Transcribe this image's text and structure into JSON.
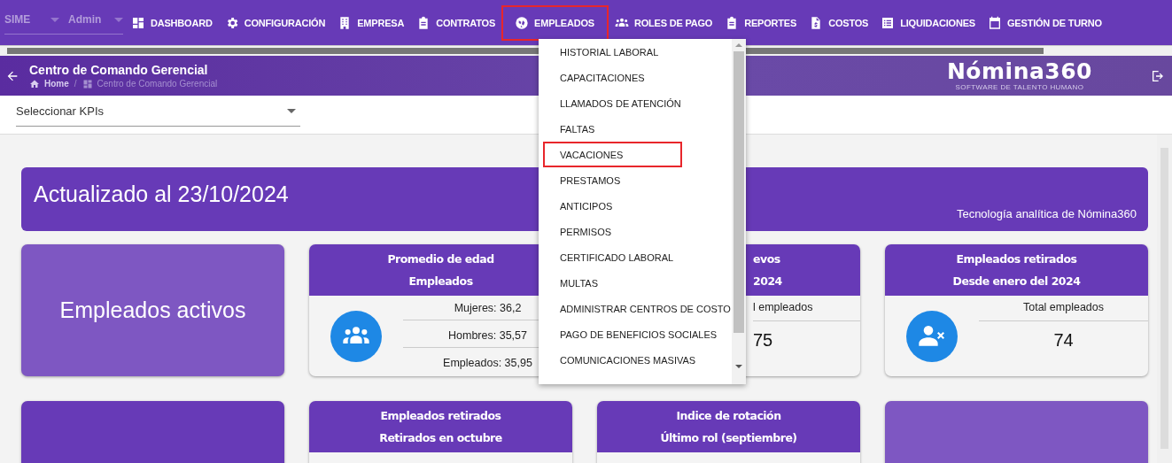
{
  "nav": {
    "selects": [
      {
        "value": "SIME"
      },
      {
        "value": "Admin"
      }
    ],
    "items": [
      {
        "label": "DASHBOARD",
        "outlined": false
      },
      {
        "label": "CONFIGURACIÓN",
        "outlined": false
      },
      {
        "label": "EMPRESA",
        "outlined": false
      },
      {
        "label": "CONTRATOS",
        "outlined": false
      },
      {
        "label": "EMPLEADOS",
        "outlined": true
      },
      {
        "label": "ROLES DE PAGO",
        "outlined": false
      },
      {
        "label": "REPORTES",
        "outlined": false
      },
      {
        "label": "COSTOS",
        "outlined": false
      },
      {
        "label": "LIQUIDACIONES",
        "outlined": false
      },
      {
        "label": "GESTIÓN DE TURNO",
        "outlined": false
      }
    ]
  },
  "header": {
    "title": "Centro de Comando Gerencial",
    "breadcrumb": [
      {
        "label": "Home"
      },
      {
        "label": "Centro de Comando Gerencial"
      }
    ],
    "breadcrumb_separator": "/",
    "logo": {
      "name": "Nómina360",
      "tagline": "SOFTWARE DE TALENTO HUMANO"
    }
  },
  "kpi_select": {
    "placeholder": "Seleccionar KPIs"
  },
  "banner": {
    "title": "Actualizado al 23/10/2024",
    "caption": "Tecnología analítica de Nómina360"
  },
  "cards": [
    {
      "kind": "title",
      "text": "Empleados activos"
    },
    {
      "kind": "stats",
      "header": [
        "Promedio de edad",
        "Empleados"
      ],
      "rows": [
        "Mujeres: 36,2",
        "Hombres: 35,57",
        "Empleados: 35,95"
      ]
    },
    {
      "kind": "total",
      "covered": true,
      "header": [
        "evos",
        "2024"
      ],
      "label": "l empleados",
      "value": "75"
    },
    {
      "kind": "total",
      "covered": false,
      "header": [
        "Empleados retirados",
        "Desde enero del 2024"
      ],
      "label": "Total empleados",
      "value": "74"
    }
  ],
  "cards_row2": [
    {
      "kind": "filled-dark"
    },
    {
      "kind": "header",
      "header": [
        "Empleados retirados",
        "Retirados en octubre"
      ]
    },
    {
      "kind": "header",
      "header": [
        "Indice de rotación",
        "Último rol (septiembre)"
      ]
    },
    {
      "kind": "filled-light"
    }
  ],
  "dropdown": {
    "items": [
      {
        "label": "HISTORIAL LABORAL",
        "outlined": false
      },
      {
        "label": "CAPACITACIONES",
        "outlined": false
      },
      {
        "label": "LLAMADOS DE ATENCIÓN",
        "outlined": false
      },
      {
        "label": "FALTAS",
        "outlined": false
      },
      {
        "label": "VACACIONES",
        "outlined": true
      },
      {
        "label": "PRESTAMOS",
        "outlined": false
      },
      {
        "label": "ANTICIPOS",
        "outlined": false
      },
      {
        "label": "PERMISOS",
        "outlined": false
      },
      {
        "label": "CERTIFICADO LABORAL",
        "outlined": false
      },
      {
        "label": "MULTAS",
        "outlined": false
      },
      {
        "label": "ADMINISTRAR CENTROS DE COSTO",
        "outlined": false
      },
      {
        "label": "PAGO DE BENEFICIOS SOCIALES",
        "outlined": false
      },
      {
        "label": "COMUNICACIONES MASIVAS",
        "outlined": false
      }
    ]
  }
}
